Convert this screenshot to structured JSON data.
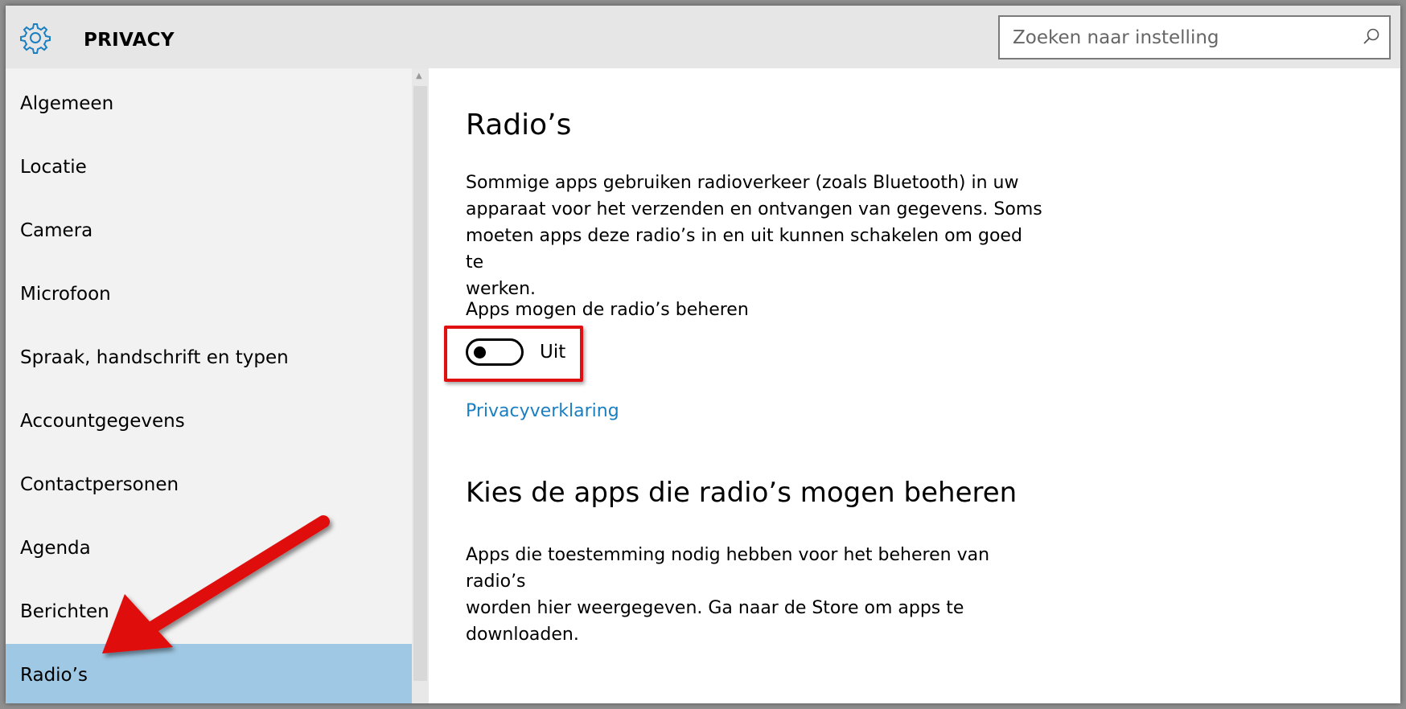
{
  "header": {
    "title": "PRIVACY",
    "search_placeholder": "Zoeken naar instelling"
  },
  "sidebar": {
    "items": [
      {
        "label": "Algemeen"
      },
      {
        "label": "Locatie"
      },
      {
        "label": "Camera"
      },
      {
        "label": "Microfoon"
      },
      {
        "label": "Spraak, handschrift en typen"
      },
      {
        "label": "Accountgegevens"
      },
      {
        "label": "Contactpersonen"
      },
      {
        "label": "Agenda"
      },
      {
        "label": "Berichten"
      },
      {
        "label": "Radio’s"
      }
    ],
    "selected": "Radio’s"
  },
  "content": {
    "heading": "Radio’s",
    "description_lines": [
      "Sommige apps gebruiken radioverkeer (zoals Bluetooth) in uw",
      "apparaat voor het verzenden en ontvangen van gegevens. Soms",
      "moeten apps deze radio’s in en uit kunnen schakelen om goed te",
      "werken."
    ],
    "toggle": {
      "label": "Apps mogen de radio’s beheren",
      "state_text": "Uit",
      "on": false
    },
    "privacy_link": "Privacyverklaring",
    "section_heading": "Kies de apps die radio’s mogen beheren",
    "section_lines": [
      "Apps die toestemming nodig hebben voor het beheren van radio’s",
      "worden hier weergegeven. Ga naar de Store om apps te",
      "downloaden."
    ]
  },
  "colors": {
    "accent": "#1a7fc1",
    "selected_bg": "#9fc8e4",
    "annotation_red": "#e01010"
  },
  "icons": [
    "gear-icon",
    "search-icon"
  ]
}
